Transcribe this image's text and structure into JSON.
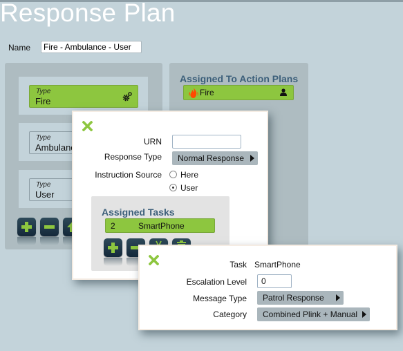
{
  "page": {
    "title": "Response Plan",
    "name_label": "Name",
    "name_value": "Fire - Ambulance - User"
  },
  "types_panel": {
    "items": [
      {
        "label": "Type",
        "value": "Fire",
        "active": true,
        "icon": "gears-icon"
      },
      {
        "label": "Type",
        "value": "Ambulance",
        "active": false
      },
      {
        "label": "Type",
        "value": "User",
        "active": false
      }
    ],
    "toolbar": [
      {
        "icon": "add-icon",
        "label": "Add"
      },
      {
        "icon": "remove-icon",
        "label": "Remove"
      },
      {
        "icon": "move-up-icon",
        "label": "Move up"
      }
    ]
  },
  "action_plans_panel": {
    "title": "Assigned To Action Plans",
    "items": [
      {
        "value": "Fire",
        "icon": "fire-icon",
        "trailing_icon": "person-icon"
      }
    ]
  },
  "type_dialog": {
    "close_icon": "close-icon",
    "urn_label": "URN",
    "urn_value": "",
    "response_type_label": "Response Type",
    "response_type_value": "Normal Response",
    "instruction_source_label": "Instruction Source",
    "instruction_source_options": [
      {
        "label": "Here",
        "checked": false
      },
      {
        "label": "User",
        "checked": true
      }
    ],
    "assigned_tasks": {
      "title": "Assigned Tasks",
      "rows": [
        {
          "number": "2",
          "name": "SmartPhone"
        }
      ],
      "toolbar": [
        {
          "icon": "add-icon"
        },
        {
          "icon": "remove-icon"
        },
        {
          "icon": "cut-icon"
        },
        {
          "icon": "trash-icon"
        }
      ]
    }
  },
  "task_dialog": {
    "close_icon": "close-icon",
    "task_label": "Task",
    "task_value": "SmartPhone",
    "escalation_label": "Escalation Level",
    "escalation_value": "0",
    "message_type_label": "Message Type",
    "message_type_value": "Patrol Response",
    "category_label": "Category",
    "category_value": "Combined Plink + Manual"
  },
  "colors": {
    "background": "#c3d3da",
    "panel": "#aebcc1",
    "accent_green": "#8dc63f",
    "title_blue": "#3c5f7a",
    "button_dark": "#1e3646"
  }
}
